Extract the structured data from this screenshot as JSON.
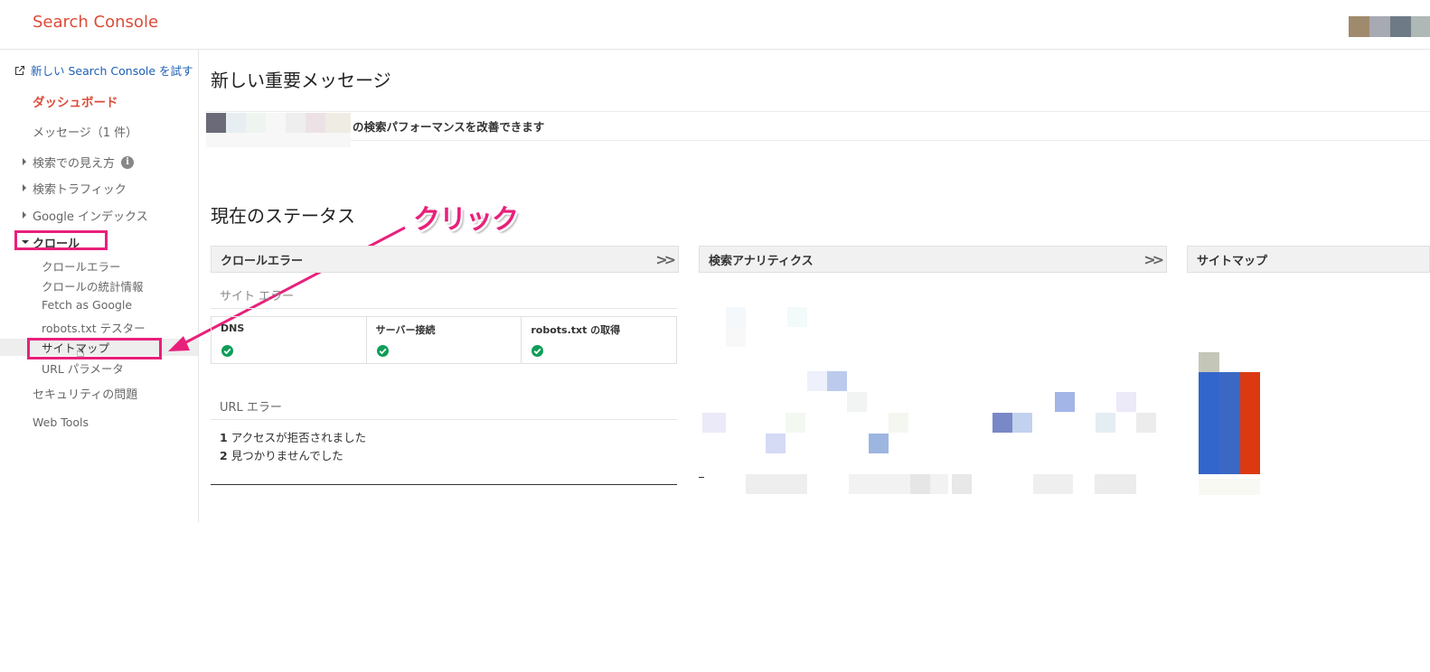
{
  "header": {
    "app_title": "Search Console",
    "avatar_colors": [
      "#a08a6e",
      "#a7aab2",
      "#6e7a86",
      "#aeb8b4"
    ]
  },
  "sidebar": {
    "new_console_link": "新しい Search Console を試す",
    "dashboard": "ダッシュボード",
    "messages": "メッセージ（1 件）",
    "search_appearance": "検索での見え方",
    "search_traffic": "検索トラフィック",
    "google_index": "Google インデックス",
    "crawl": "クロール",
    "crawl_items": {
      "crawl_errors": "クロールエラー",
      "crawl_stats": "クロールの統計情報",
      "fetch_as_google": "Fetch as Google",
      "robots_tester": "robots.txt テスター",
      "sitemaps": "サイトマップ",
      "url_parameters": "URL パラメータ"
    },
    "security_issues": "セキュリティの問題",
    "web_tools": "Web Tools"
  },
  "main": {
    "important_messages_title": "新しい重要メッセージ",
    "message_text": "の検索パフォーマンスを改善できます",
    "status_title": "現在のステータス",
    "annotation_label": "クリック",
    "crawl_errors_card": {
      "title": "クロールエラー",
      "site_errors_label": "サイト エラー",
      "status_columns": [
        {
          "label": "DNS",
          "ok": true
        },
        {
          "label": "サーバー接続",
          "ok": true
        },
        {
          "label": "robots.txt の取得",
          "ok": true
        }
      ],
      "url_errors_label": "URL エラー",
      "url_errors": [
        {
          "count": "1",
          "text": "アクセスが拒否されました"
        },
        {
          "count": "2",
          "text": "見つかりませんでした"
        }
      ]
    },
    "analytics_card": {
      "title": "検索アナリティクス"
    },
    "sitemaps_card": {
      "title": "サイトマップ"
    }
  },
  "colors": {
    "brand_red": "#dd4b39",
    "highlight_pink": "#e8207a",
    "link_blue": "#1a5fb4",
    "ok_green": "#0f9d58",
    "sitemap_bar_blue": "#3366cc",
    "sitemap_bar_red": "#dc3912"
  }
}
